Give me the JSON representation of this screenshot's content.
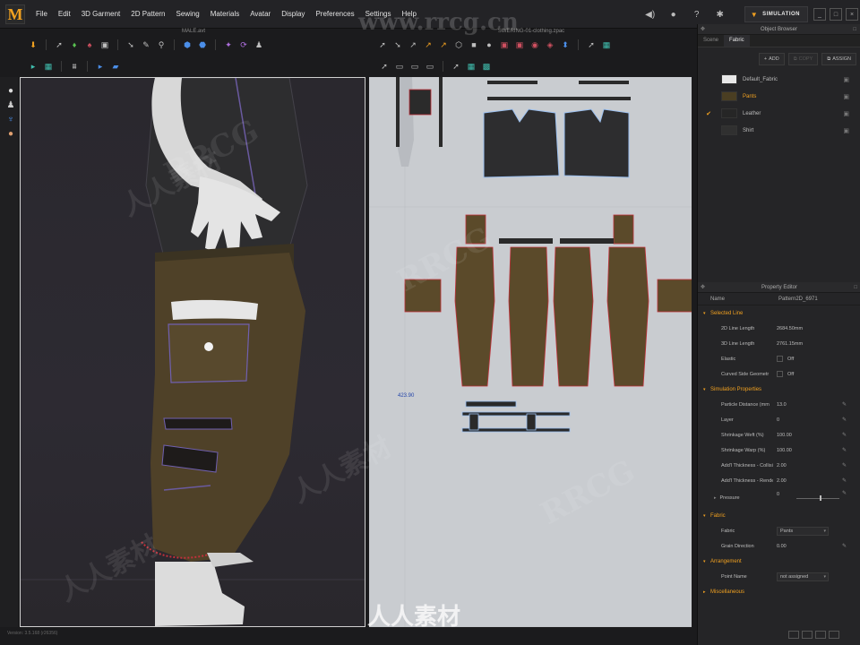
{
  "menu": {
    "logo": "M",
    "items": [
      "File",
      "Edit",
      "3D Garment",
      "2D Pattern",
      "Sewing",
      "Materials",
      "Avatar",
      "Display",
      "Preferences",
      "Settings",
      "Help"
    ]
  },
  "topbar": {
    "simulation_label": "SIMULATION",
    "icons": [
      "speaker-icon",
      "user-icon",
      "help-icon",
      "tshirt-settings-icon"
    ]
  },
  "viewports": {
    "title_3d": "MALE.avt",
    "title_2d": "SWERING-01-clothing.zpac",
    "measure_label": "423.90",
    "footer_3d": "Version: 3.5.168      (r26356)"
  },
  "object_browser": {
    "title": "Object Browser",
    "tabs": [
      "Scene",
      "Fabric"
    ],
    "active_tab": "Fabric",
    "add_label": "ADD",
    "copy_label": "COPY",
    "assign_label": "ASSIGN",
    "fabrics": [
      {
        "name": "Default_Fabric",
        "swatch": "#e8e8e8",
        "checked": false,
        "active": false
      },
      {
        "name": "Pants",
        "swatch": "#4a3e22",
        "checked": false,
        "active": true
      },
      {
        "name": "Leather",
        "swatch": "#262626",
        "checked": true,
        "active": false
      },
      {
        "name": "Shirt",
        "swatch": "#303030",
        "checked": false,
        "active": false
      }
    ]
  },
  "property_editor": {
    "title": "Property Editor",
    "name_key": "Name",
    "name_value": "Pattern2D_6971",
    "sections": {
      "selected_line": {
        "label": "Selected Line",
        "rows": [
          {
            "k": "2D Line Length",
            "v": "2684.50mm"
          },
          {
            "k": "3D Line Length",
            "v": "2761.15mm"
          },
          {
            "k": "Elastic",
            "v": "Off"
          },
          {
            "k": "Curved Side Geometr",
            "v": "Off"
          }
        ]
      },
      "simulation": {
        "label": "Simulation Properties",
        "rows": [
          {
            "k": "Particle Distance (mm",
            "v": "13.0"
          },
          {
            "k": "Layer",
            "v": "0"
          },
          {
            "k": "Shrinkage Weft (%)",
            "v": "100.00"
          },
          {
            "k": "Shrinkage Warp (%)",
            "v": "100.00"
          },
          {
            "k": "Add'l Thickness - Collision",
            "v": "2.00"
          },
          {
            "k": "Add'l Thickness - Rendering",
            "v": "2.00"
          },
          {
            "k": "Pressure",
            "v": "0"
          }
        ]
      },
      "fabric": {
        "label": "Fabric",
        "rows": [
          {
            "k": "Fabric",
            "v": "Pants"
          },
          {
            "k": "Grain Direction",
            "v": "0.00"
          }
        ]
      },
      "arrangement": {
        "label": "Arrangement",
        "rows": [
          {
            "k": "Point Name",
            "v": "not assigned"
          }
        ]
      },
      "misc": {
        "label": "Miscellaneous"
      }
    }
  },
  "watermark": {
    "text1": "www.rrcg.cn",
    "text2": "RRCG",
    "text3": "人人素材"
  },
  "colors": {
    "accent": "#f0a020",
    "pants": "#5b4a2a",
    "leather": "#2b2b2b",
    "seam_red": "#c0303a",
    "selection_blue": "#9cc0f0"
  }
}
